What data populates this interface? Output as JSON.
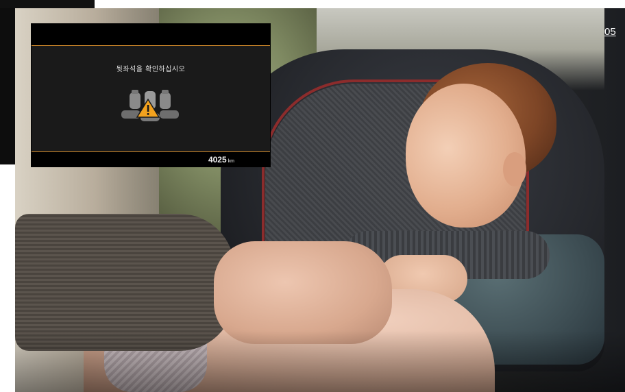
{
  "page": {
    "number": "05"
  },
  "cluster": {
    "warning_message": "뒷좌석을 확인하십시오",
    "odometer_value": "4025",
    "odometer_unit": "km",
    "icon": "rear-seat-warning-icon",
    "accent_color": "#d0892a",
    "warning_color": "#f3a21e"
  },
  "photo": {
    "subject": "child-in-car-seat-photo"
  }
}
